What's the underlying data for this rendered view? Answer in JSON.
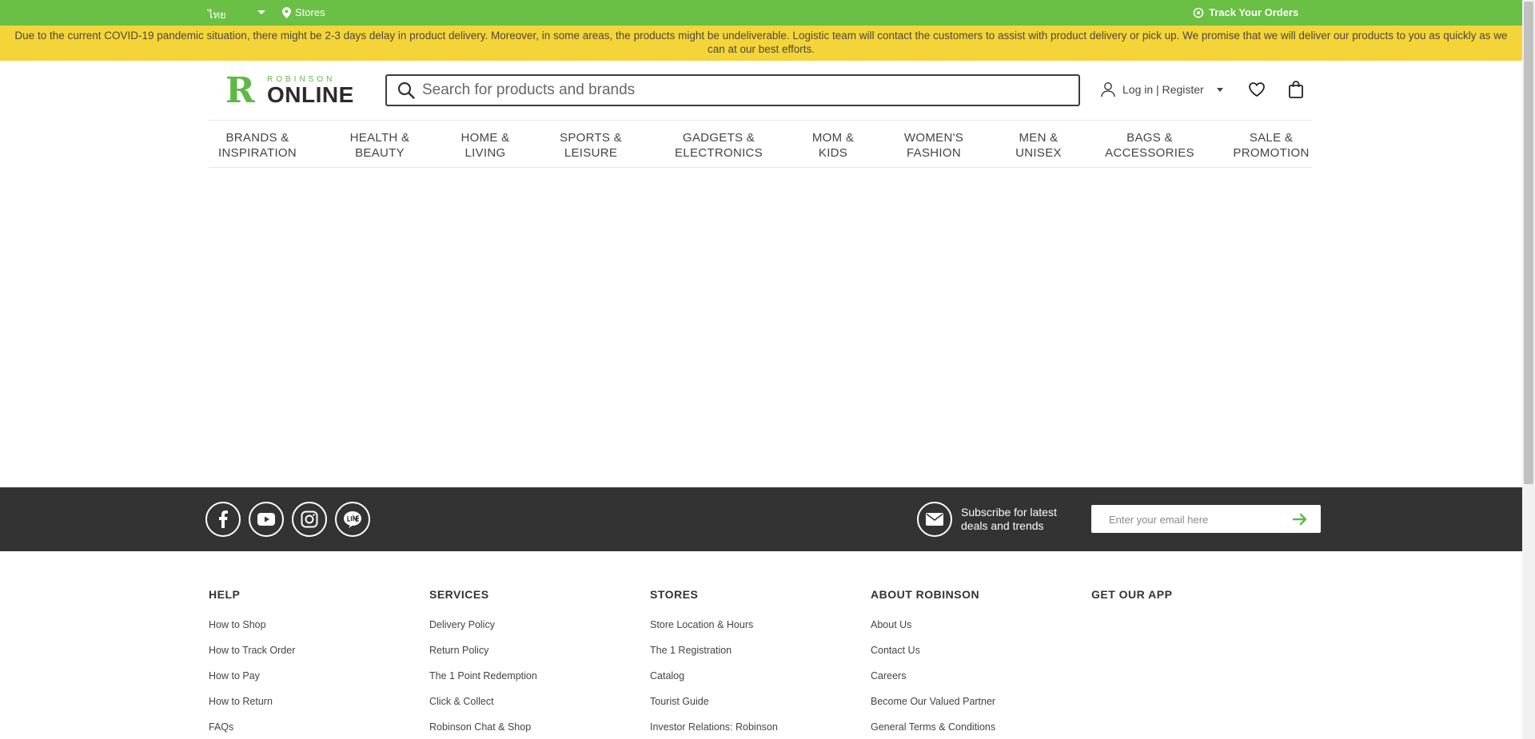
{
  "topbar": {
    "language": "ไทย",
    "stores": "Stores",
    "track_orders": "Track Your Orders"
  },
  "notice": {
    "text": "Due to the current COVID-19 pandemic situation, there might be 2-3 days delay in product delivery. Moreover, in some areas, the products might be undeliverable. Logistic team will contact the customers to assist with product delivery or pick up. We promise that we will deliver our products to you as quickly as we can at our best efforts."
  },
  "logo": {
    "letter": "R",
    "top": "ROBINSON",
    "bottom": "ONLINE"
  },
  "search": {
    "placeholder": "Search for products and brands"
  },
  "account": {
    "login_label": "Log in | Register"
  },
  "nav": [
    "BRANDS &\nINSPIRATION",
    "HEALTH &\nBEAUTY",
    "HOME &\nLIVING",
    "SPORTS &\nLEISURE",
    "GADGETS &\nELECTRONICS",
    "MOM &\nKIDS",
    "WOMEN'S\nFASHION",
    "MEN &\nUNISEX",
    "BAGS &\nACCESSORIES",
    "SALE &\nPROMOTION"
  ],
  "subscribe": {
    "text": "Subscribe for latest deals and trends",
    "placeholder": "Enter your email here"
  },
  "footer": {
    "help": {
      "title": "HELP",
      "links": [
        "How to Shop",
        "How to Track Order",
        "How to Pay",
        "How to Return",
        "FAQs"
      ]
    },
    "services": {
      "title": "SERVICES",
      "links": [
        "Delivery Policy",
        "Return Policy",
        "The 1 Point Redemption",
        "Click & Collect",
        "Robinson Chat & Shop"
      ]
    },
    "stores": {
      "title": "STORES",
      "links": [
        "Store Location & Hours",
        "The 1 Registration",
        "Catalog",
        "Tourist Guide",
        "Investor Relations: Robinson"
      ]
    },
    "about": {
      "title": "ABOUT ROBINSON",
      "links": [
        "About Us",
        "Contact Us",
        "Careers",
        "Become Our Valued Partner",
        "General Terms & Conditions"
      ]
    },
    "app": {
      "title": "GET OUR APP"
    }
  },
  "colors": {
    "topbar": "#6abf45",
    "notice": "#f5d43a",
    "band": "#333333",
    "brand_green": "#5fb846"
  }
}
